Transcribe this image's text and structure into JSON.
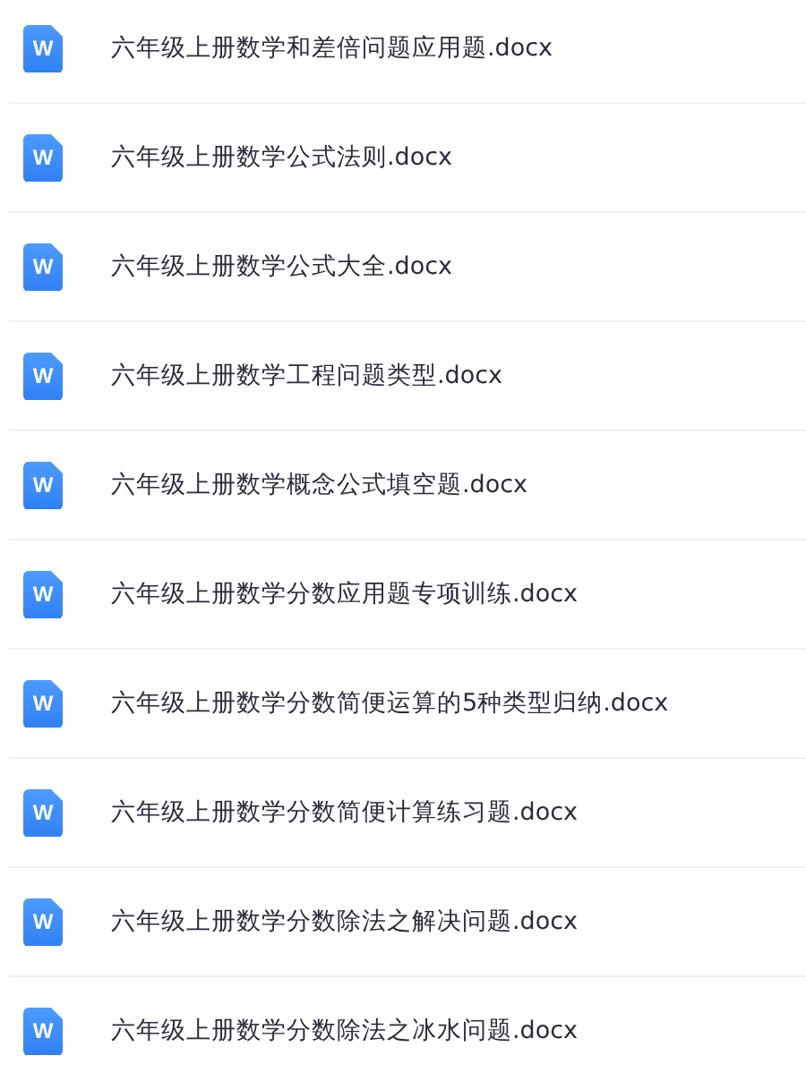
{
  "files": [
    {
      "name": "六年级上册数学和差倍问题应用题.docx",
      "icon_letter": "W"
    },
    {
      "name": "六年级上册数学公式法则.docx",
      "icon_letter": "W"
    },
    {
      "name": "六年级上册数学公式大全.docx",
      "icon_letter": "W"
    },
    {
      "name": "六年级上册数学工程问题类型.docx",
      "icon_letter": "W"
    },
    {
      "name": "六年级上册数学概念公式填空题.docx",
      "icon_letter": "W"
    },
    {
      "name": "六年级上册数学分数应用题专项训练.docx",
      "icon_letter": "W"
    },
    {
      "name": "六年级上册数学分数简便运算的5种类型归纳.docx",
      "icon_letter": "W"
    },
    {
      "name": "六年级上册数学分数简便计算练习题.docx",
      "icon_letter": "W"
    },
    {
      "name": "六年级上册数学分数除法之解决问题.docx",
      "icon_letter": "W"
    },
    {
      "name": "六年级上册数学分数除法之冰水问题.docx",
      "icon_letter": "W"
    }
  ]
}
